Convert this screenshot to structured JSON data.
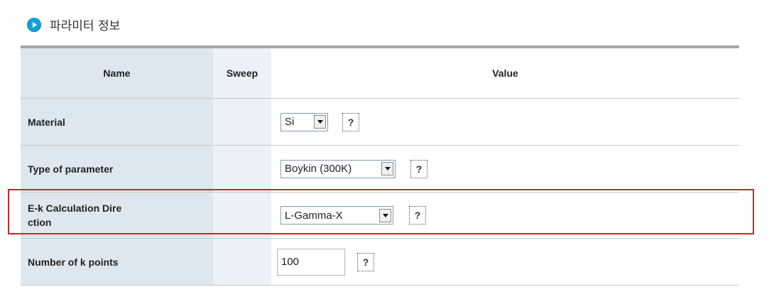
{
  "section": {
    "icon": "play-circle-icon",
    "title": "파라미터 정보"
  },
  "table": {
    "headers": {
      "name": "Name",
      "sweep": "Sweep",
      "value": "Value"
    },
    "rows": [
      {
        "name": "Material",
        "control": "select",
        "value": "Si",
        "help": "?"
      },
      {
        "name": "Type of parameter",
        "control": "select",
        "value": "Boykin (300K)",
        "help": "?"
      },
      {
        "name_line1": "E-k Calculation Dire",
        "name_line2": "ction",
        "control": "select",
        "value": "L-Gamma-X",
        "help": "?",
        "highlighted": true
      },
      {
        "name": "Number of k points",
        "control": "text",
        "value": "100",
        "help": "?"
      }
    ]
  },
  "colors": {
    "accent_icon": "#18a1d6",
    "name_column_bg": "#dde7f0",
    "sweep_column_bg": "#ebf1f6",
    "highlight_border": "#c82828"
  }
}
